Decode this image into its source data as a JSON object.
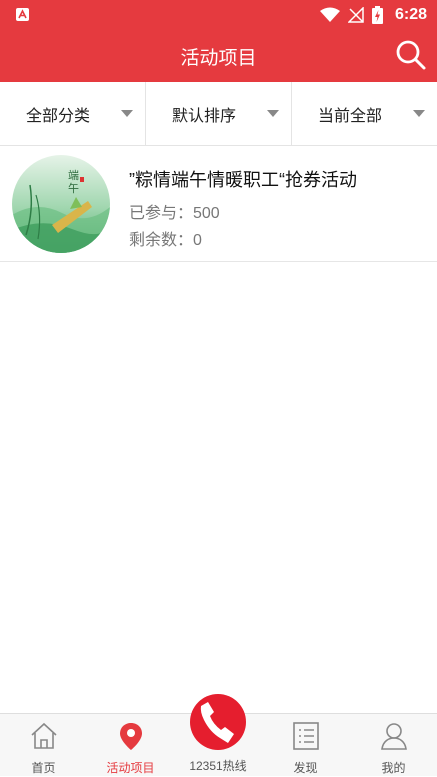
{
  "status_bar": {
    "time": "6:28"
  },
  "header": {
    "title": "活动项目"
  },
  "filters": [
    {
      "label": "全部分类"
    },
    {
      "label": "默认排序"
    },
    {
      "label": "当前全部"
    }
  ],
  "activities": [
    {
      "title": "”粽情端午情暖职工“抢券活动",
      "joined": "已参与：500",
      "remaining": "剩余数：0"
    }
  ],
  "tabs": [
    {
      "label": "首页",
      "icon": "home-icon"
    },
    {
      "label": "活动项目",
      "icon": "location-pin-icon",
      "active": true
    },
    {
      "label": "12351热线",
      "icon": "phone-icon"
    },
    {
      "label": "发现",
      "icon": "list-icon"
    },
    {
      "label": "我的",
      "icon": "person-icon"
    }
  ],
  "colors": {
    "brand_red": "#e53a3f",
    "hotline_red": "#e51e2e"
  }
}
